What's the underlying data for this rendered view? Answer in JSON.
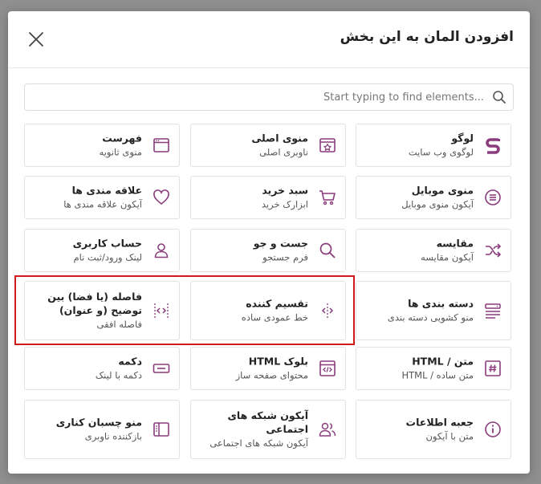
{
  "modal": {
    "title": "افزودن المان به این بخش",
    "search_placeholder": "Start typing to find elements..."
  },
  "colors": {
    "icon_accent": "#8a3c7c",
    "highlight_border": "#d11a1a"
  },
  "elements": [
    {
      "title": "لوگو",
      "subtitle": "لوگوی وب سایت",
      "icon": "logo-s-icon"
    },
    {
      "title": "منوی اصلی",
      "subtitle": "ناوبری اصلی",
      "icon": "main-menu-icon"
    },
    {
      "title": "فهرست",
      "subtitle": "منوی ثانویه",
      "icon": "browser-window-icon"
    },
    {
      "title": "منوی موبایل",
      "subtitle": "آیکون منوی موبایل",
      "icon": "mobile-menu-icon"
    },
    {
      "title": "سبد خرید",
      "subtitle": "ابزارک خرید",
      "icon": "cart-icon"
    },
    {
      "title": "علاقه مندی ها",
      "subtitle": "آیکون علاقه مندی ها",
      "icon": "heart-icon"
    },
    {
      "title": "مقایسه",
      "subtitle": "آیکون مقایسه",
      "icon": "shuffle-icon"
    },
    {
      "title": "جست و جو",
      "subtitle": "فرم جستجو",
      "icon": "search-icon"
    },
    {
      "title": "حساب کاربری",
      "subtitle": "لینک ورود/ثبت نام",
      "icon": "user-icon"
    },
    {
      "title": "دسته بندی ها",
      "subtitle": "منو کشویی دسته بندی",
      "icon": "categories-icon"
    },
    {
      "title": "تقسیم کننده",
      "subtitle": "خط عمودی ساده",
      "icon": "divider-icon"
    },
    {
      "title": "فاصله (یا فضا) بین توضیح (و عنوان)",
      "subtitle": "فاصله افقی",
      "icon": "spacer-icon"
    },
    {
      "title": "متن / HTML",
      "subtitle": "متن ساده / HTML",
      "icon": "text-hash-icon"
    },
    {
      "title": "بلوک HTML",
      "subtitle": "محتوای صفحه ساز",
      "icon": "html-block-icon"
    },
    {
      "title": "دکمه",
      "subtitle": "دکمه با لینک",
      "icon": "button-icon"
    },
    {
      "title": "جعبه اطلاعات",
      "subtitle": "متن با آیکون",
      "icon": "info-icon"
    },
    {
      "title": "آیکون شبکه های اجتماعی",
      "subtitle": "آیکون شبکه های اجتماعی",
      "icon": "social-users-icon"
    },
    {
      "title": "منو چسبان کناری",
      "subtitle": "بازکننده ناوبری",
      "icon": "sidebar-menu-icon"
    }
  ]
}
